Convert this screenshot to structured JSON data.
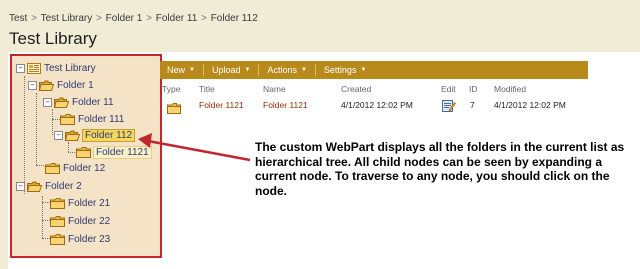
{
  "breadcrumb": {
    "items": [
      "Test",
      "Test Library",
      "Folder 1",
      "Folder 11",
      "Folder 112"
    ],
    "separator": ">"
  },
  "page_title": "Test Library",
  "tree": {
    "root": "Test Library",
    "folder_1": "Folder 1",
    "folder_11": "Folder 11",
    "folder_111": "Folder 111",
    "folder_112": "Folder 112",
    "folder_1121": "Folder 1121",
    "folder_12": "Folder 12",
    "folder_2": "Folder 2",
    "folder_21": "Folder 21",
    "folder_22": "Folder 22",
    "folder_23": "Folder 23",
    "toggle_expanded": "−"
  },
  "toolbar": {
    "new_label": "New",
    "upload_label": "Upload",
    "actions_label": "Actions",
    "settings_label": "Settings",
    "dropdown_arrow": "▼"
  },
  "list": {
    "columns": {
      "type": "Type",
      "title": "Title",
      "name": "Name",
      "created": "Created",
      "edit": "Edit",
      "id": "ID",
      "modified": "Modified"
    },
    "rows": [
      {
        "title": "Folder 1121",
        "name": "Folder 1121",
        "created": "4/1/2012 12:02 PM",
        "id": "7",
        "modified": "4/1/2012 12:02 PM"
      }
    ]
  },
  "annotation": "The custom WebPart displays all the folders in the current list as hierarchical tree. All child nodes can be seen by expanding a current node. To traverse to any node, you should click on the node.",
  "colors": {
    "header_bg": "#f1ecd6",
    "tree_bg": "#f4e3c7",
    "highlight_border": "#c1272d",
    "toolbar_bg": "#b88a1c",
    "link_text": "#8e2e00"
  }
}
